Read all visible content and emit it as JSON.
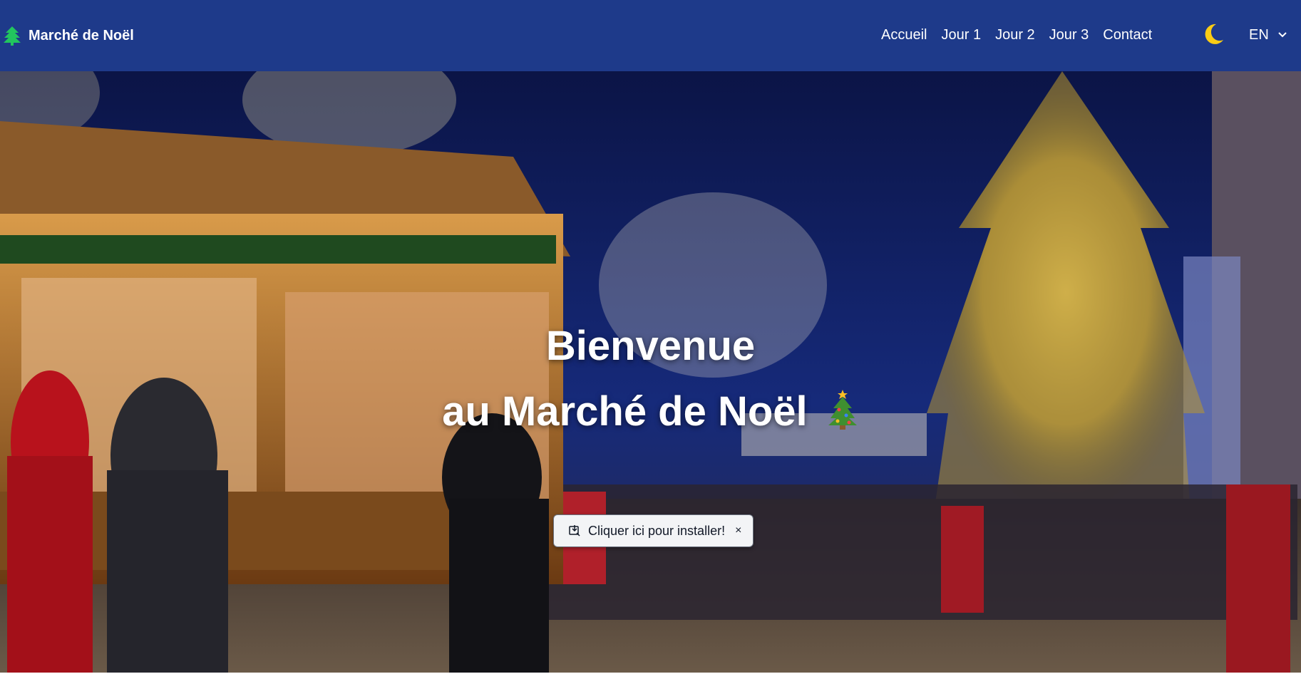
{
  "navbar": {
    "brand": "Marché de Noël",
    "brand_icon": "tree-icon",
    "links": [
      "Accueil",
      "Jour 1",
      "Jour 2",
      "Jour 3",
      "Contact"
    ],
    "theme_icon": "moon-icon",
    "language": "EN",
    "background": "#1e3a8a"
  },
  "hero": {
    "title_line1": "Bienvenue",
    "title_line2": "au Marché de Noël",
    "title_icon": "christmas-tree-icon",
    "install_label": "Cliquer ici pour installer!",
    "close_label": "×"
  },
  "colors": {
    "accent_moon": "#facc15",
    "tree_green": "#22c55e"
  }
}
